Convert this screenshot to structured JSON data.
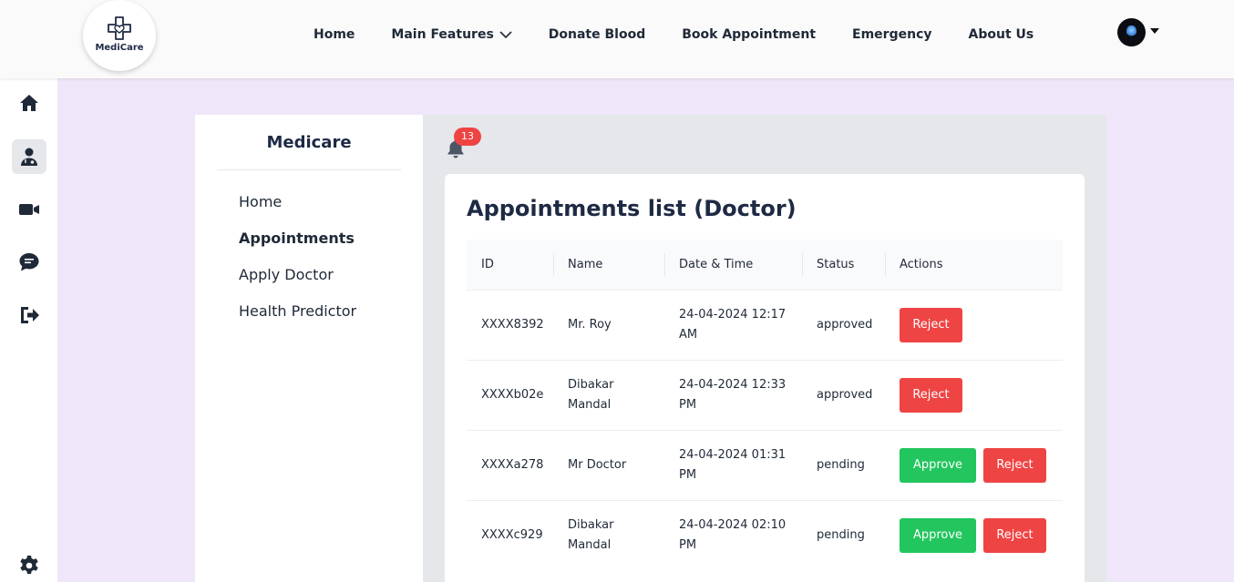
{
  "brand": {
    "logo_text": "MediCare"
  },
  "nav": {
    "items": [
      "Home",
      "Main Features",
      "Donate Blood",
      "Book Appointment",
      "Emergency",
      "About Us"
    ]
  },
  "sidebar": {
    "title": "Medicare",
    "items": [
      "Home",
      "Appointments",
      "Apply Doctor",
      "Health Predictor"
    ],
    "active": "Appointments"
  },
  "notifications": {
    "count": "13"
  },
  "appointments": {
    "title": "Appointments list (Doctor)",
    "columns": [
      "ID",
      "Name",
      "Date & Time",
      "Status",
      "Actions"
    ],
    "approve_label": "Approve",
    "reject_label": "Reject",
    "rows": [
      {
        "id": "XXXX8392",
        "name": "Mr. Roy",
        "datetime": "24-04-2024 12:17 AM",
        "status": "approved"
      },
      {
        "id": "XXXXb02e",
        "name": "Dibakar Mandal",
        "datetime": "24-04-2024 12:33 PM",
        "status": "approved"
      },
      {
        "id": "XXXXa278",
        "name": "Mr Doctor",
        "datetime": "24-04-2024 01:31 PM",
        "status": "pending"
      },
      {
        "id": "XXXXc929",
        "name": "Dibakar Mandal",
        "datetime": "24-04-2024 02:10 PM",
        "status": "pending"
      }
    ]
  },
  "colors": {
    "brand_navy": "#1e2a44",
    "approve": "#22c55e",
    "reject": "#ef4444",
    "page_bg": "#efe7f9",
    "badge": "#ef4444"
  }
}
